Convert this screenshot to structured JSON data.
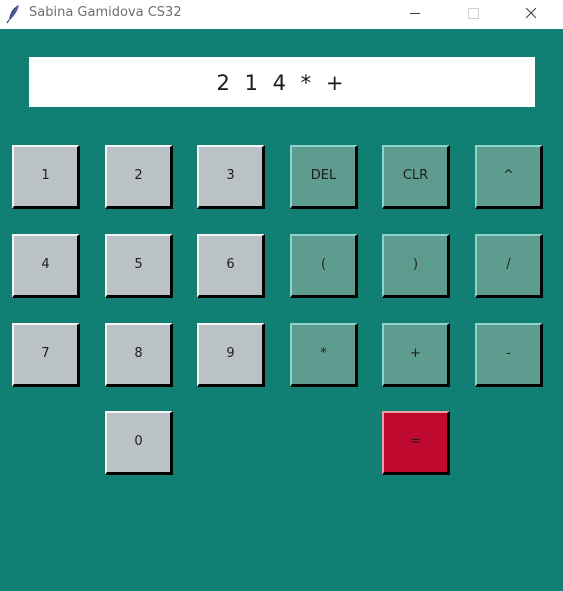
{
  "window": {
    "title": "Sabina Gamidova CS32",
    "app_icon": "feather-icon",
    "controls": {
      "minimize_icon": "minimize-icon",
      "maximize_icon": "maximize-icon",
      "close_icon": "close-icon"
    }
  },
  "display": {
    "value": "2 1 4 * +"
  },
  "buttons": {
    "one": "1",
    "two": "2",
    "three": "3",
    "del": "DEL",
    "clr": "CLR",
    "power": "^",
    "four": "4",
    "five": "5",
    "six": "6",
    "open_paren": "(",
    "close_paren": ")",
    "divide": "/",
    "seven": "7",
    "eight": "8",
    "nine": "9",
    "multiply": "*",
    "plus": "+",
    "minus": "-",
    "zero": "0",
    "equals": "="
  },
  "colors": {
    "background": "#117f74",
    "number_button": "#bac2c6",
    "operator_button": "#5e9c8f",
    "equals_button": "#c0092f",
    "display_background": "#ffffff"
  }
}
